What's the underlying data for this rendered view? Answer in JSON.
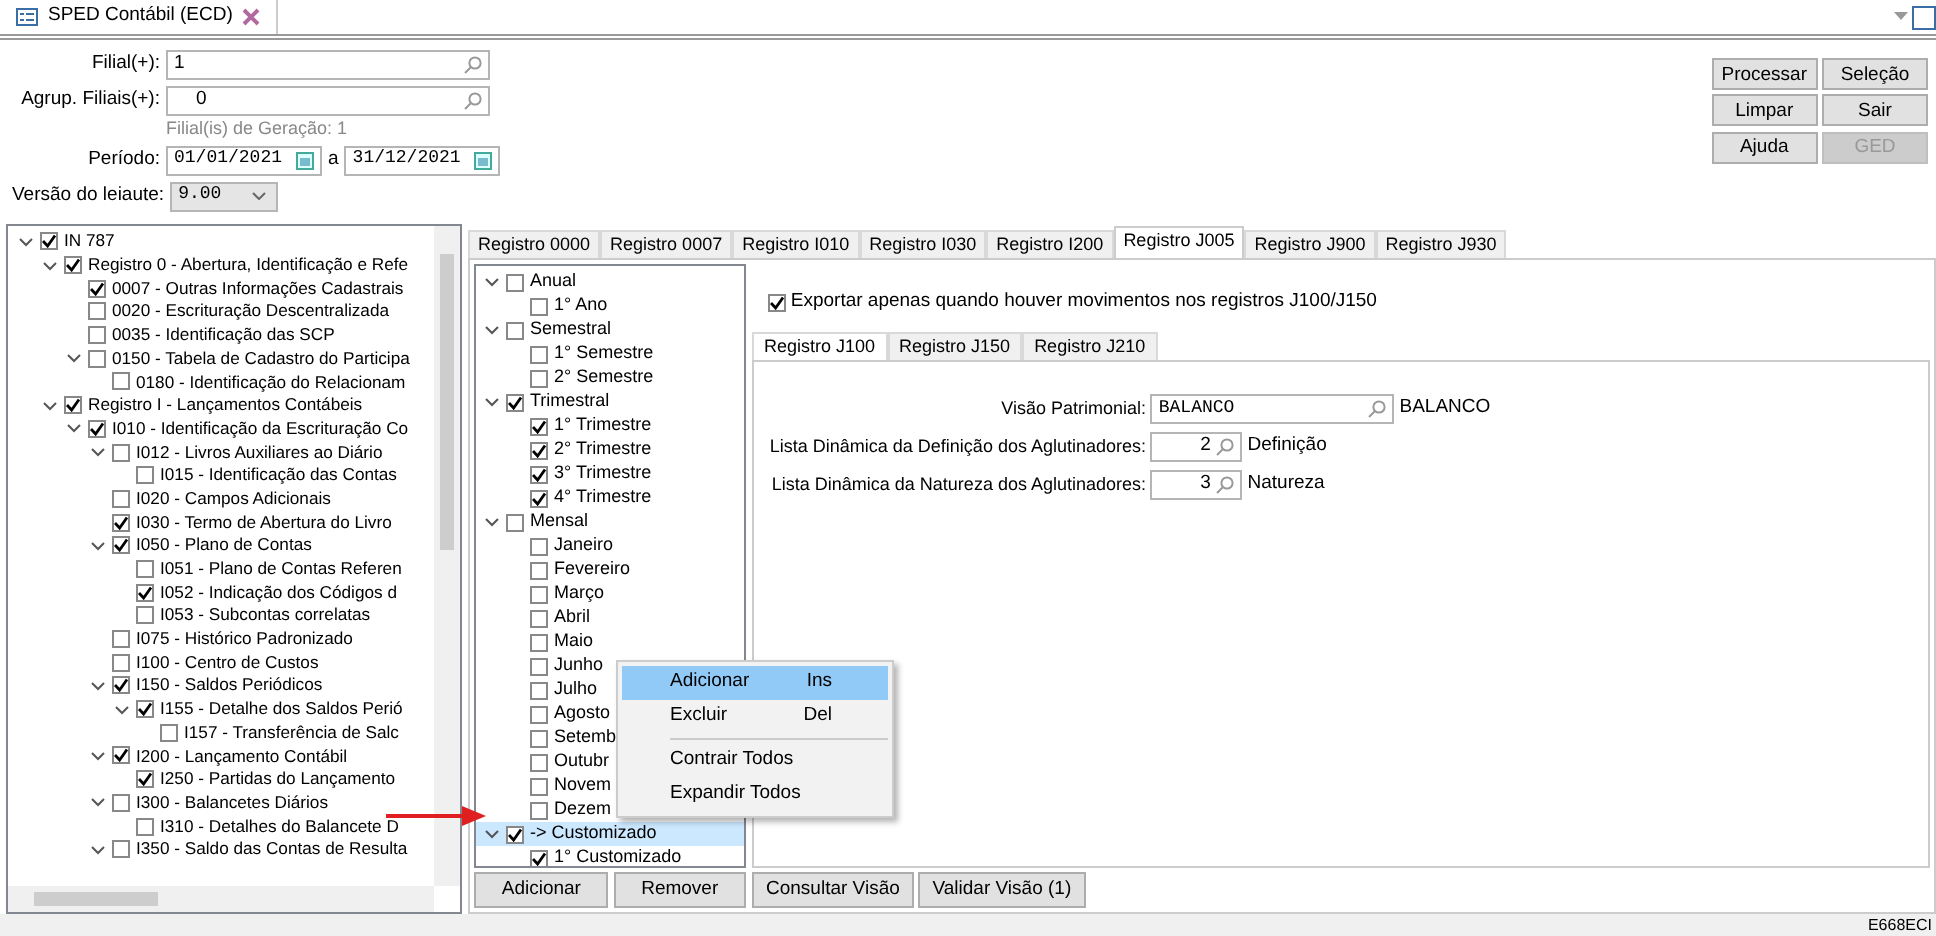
{
  "window": {
    "tab": "SPED Contábil (ECD)"
  },
  "form": {
    "filial": {
      "label": "Filial(+):",
      "value": "1"
    },
    "agrup": {
      "label": "Agrup. Filiais(+):",
      "value": "0"
    },
    "hint": "Filial(is) de Geração: 1",
    "periodo": {
      "label": "Período:",
      "from": "01/01/2021",
      "sep": "a",
      "to": "31/12/2021"
    },
    "versao": {
      "label": "Versão do leiaute:",
      "value": "9.00"
    }
  },
  "actions": [
    {
      "label": "Processar",
      "disabled": false
    },
    {
      "label": "Seleção",
      "disabled": false
    },
    {
      "label": "Limpar",
      "disabled": false
    },
    {
      "label": "Sair",
      "disabled": false
    },
    {
      "label": "Ajuda",
      "disabled": false
    },
    {
      "label": "GED",
      "disabled": true
    }
  ],
  "tree": [
    {
      "label": "IN 787",
      "checked": true,
      "expanded": true,
      "children": [
        {
          "label": "Registro 0 - Abertura, Identificação e Refe",
          "checked": true,
          "expanded": true,
          "children": [
            {
              "label": "0007 - Outras Informações Cadastrais",
              "checked": true
            },
            {
              "label": "0020 - Escrituração Descentralizada",
              "checked": false
            },
            {
              "label": "0035 - Identificação das SCP",
              "checked": false
            },
            {
              "label": "0150 - Tabela de Cadastro do Participa",
              "checked": false,
              "expanded": true,
              "children": [
                {
                  "label": "0180 - Identificação do Relacionam",
                  "checked": false
                }
              ]
            }
          ]
        },
        {
          "label": "Registro I - Lançamentos Contábeis",
          "checked": true,
          "expanded": true,
          "children": [
            {
              "label": "I010 - Identificação da Escrituração Co",
              "checked": true,
              "expanded": true,
              "children": [
                {
                  "label": "I012 - Livros Auxiliares ao Diário",
                  "checked": false,
                  "expanded": true,
                  "children": [
                    {
                      "label": "I015 - Identificação das Contas",
                      "checked": false
                    }
                  ]
                },
                {
                  "label": "I020 - Campos Adicionais",
                  "checked": false
                },
                {
                  "label": "I030 - Termo de Abertura do Livro",
                  "checked": true
                },
                {
                  "label": "I050 - Plano de Contas",
                  "checked": true,
                  "expanded": true,
                  "children": [
                    {
                      "label": "I051 - Plano de Contas Referen",
                      "checked": false
                    },
                    {
                      "label": "I052 - Indicação dos Códigos d",
                      "checked": true
                    },
                    {
                      "label": "I053 - Subcontas correlatas",
                      "checked": false
                    }
                  ]
                },
                {
                  "label": "I075 - Histórico Padronizado",
                  "checked": false
                },
                {
                  "label": "I100 - Centro de Custos",
                  "checked": false
                },
                {
                  "label": "I150 - Saldos Periódicos",
                  "checked": true,
                  "expanded": true,
                  "children": [
                    {
                      "label": "I155 - Detalhe dos Saldos Perió",
                      "checked": true,
                      "expanded": true,
                      "children": [
                        {
                          "label": "I157 - Transferência de Salc",
                          "checked": false
                        }
                      ]
                    }
                  ]
                },
                {
                  "label": "I200 - Lançamento Contábil",
                  "checked": true,
                  "expanded": true,
                  "children": [
                    {
                      "label": "I250 - Partidas do Lançamento",
                      "checked": true
                    }
                  ]
                },
                {
                  "label": "I300 - Balancetes Diários",
                  "checked": false,
                  "expanded": true,
                  "children": [
                    {
                      "label": "I310 - Detalhes do Balancete D",
                      "checked": false
                    }
                  ]
                },
                {
                  "label": "I350 - Saldo das Contas de Resulta",
                  "checked": false,
                  "expanded": true
                }
              ]
            }
          ]
        }
      ]
    }
  ],
  "tabs": [
    {
      "label": "Registro 0000",
      "selected": false
    },
    {
      "label": "Registro 0007",
      "selected": false
    },
    {
      "label": "Registro I010",
      "selected": false
    },
    {
      "label": "Registro I030",
      "selected": false
    },
    {
      "label": "Registro I200",
      "selected": false
    },
    {
      "label": "Registro J005",
      "selected": true
    },
    {
      "label": "Registro J900",
      "selected": false
    },
    {
      "label": "Registro J930",
      "selected": false
    }
  ],
  "periods": [
    {
      "label": "Anual",
      "checked": false,
      "selected": false,
      "expanded": true,
      "children": [
        {
          "label": "1° Ano",
          "checked": false,
          "selected": false
        }
      ]
    },
    {
      "label": "Semestral",
      "checked": false,
      "selected": false,
      "expanded": true,
      "children": [
        {
          "label": "1° Semestre",
          "checked": false,
          "selected": false
        },
        {
          "label": "2° Semestre",
          "checked": false,
          "selected": false
        }
      ]
    },
    {
      "label": "Trimestral",
      "checked": true,
      "selected": false,
      "expanded": true,
      "children": [
        {
          "label": "1° Trimestre",
          "checked": true,
          "selected": false
        },
        {
          "label": "2° Trimestre",
          "checked": true,
          "selected": false
        },
        {
          "label": "3° Trimestre",
          "checked": true,
          "selected": false
        },
        {
          "label": "4° Trimestre",
          "checked": true,
          "selected": false
        }
      ]
    },
    {
      "label": "Mensal",
      "checked": false,
      "selected": false,
      "expanded": true,
      "children": [
        {
          "label": "Janeiro",
          "checked": false,
          "selected": false
        },
        {
          "label": "Fevereiro",
          "checked": false,
          "selected": false
        },
        {
          "label": "Março",
          "checked": false,
          "selected": false
        },
        {
          "label": "Abril",
          "checked": false,
          "selected": false
        },
        {
          "label": "Maio",
          "checked": false,
          "selected": false
        },
        {
          "label": "Junho",
          "checked": false,
          "selected": false
        },
        {
          "label": "Julho",
          "checked": false,
          "selected": false
        },
        {
          "label": "Agosto",
          "checked": false,
          "selected": false
        },
        {
          "label": "Setemb",
          "checked": false,
          "selected": false
        },
        {
          "label": "Outubr",
          "checked": false,
          "selected": false
        },
        {
          "label": "Novem",
          "checked": false,
          "selected": false
        },
        {
          "label": "Dezem",
          "checked": false,
          "selected": false
        }
      ]
    },
    {
      "label": "-> Customizado",
      "checked": true,
      "selected": true,
      "expanded": true,
      "children": [
        {
          "label": "1° Customizado",
          "checked": true,
          "selected": false
        }
      ]
    }
  ],
  "period_buttons": [
    "Adicionar",
    "Remover"
  ],
  "export_only": {
    "label": "Exportar apenas quando houver movimentos nos registros J100/J150",
    "checked": true
  },
  "subtabs": [
    {
      "label": "Registro J100",
      "selected": true
    },
    {
      "label": "Registro J150",
      "selected": false
    },
    {
      "label": "Registro J210",
      "selected": false
    }
  ],
  "fields": [
    {
      "label": "Visão Patrimonial:",
      "value": "BALANCO",
      "desc": "BALANCO",
      "kind": "wide"
    },
    {
      "label": "Lista Dinâmica da Definição dos Aglutinadores:",
      "value": "2",
      "desc": "Definição",
      "kind": "number"
    },
    {
      "label": "Lista Dinâmica da Natureza dos Aglutinadores:",
      "value": "3",
      "desc": "Natureza",
      "kind": "number"
    }
  ],
  "view_buttons": [
    "Consultar Visão",
    "Validar Visão (1)"
  ],
  "context_menu": [
    {
      "label": "Adicionar",
      "shortcut": "Ins",
      "selected": true
    },
    {
      "label": "Excluir",
      "shortcut": "Del",
      "selected": false
    },
    {
      "kind": "separator"
    },
    {
      "label": "Contrair Todos",
      "selected": false
    },
    {
      "label": "Expandir Todos",
      "selected": false
    }
  ],
  "status_bar": {
    "text": "E668ECI"
  }
}
